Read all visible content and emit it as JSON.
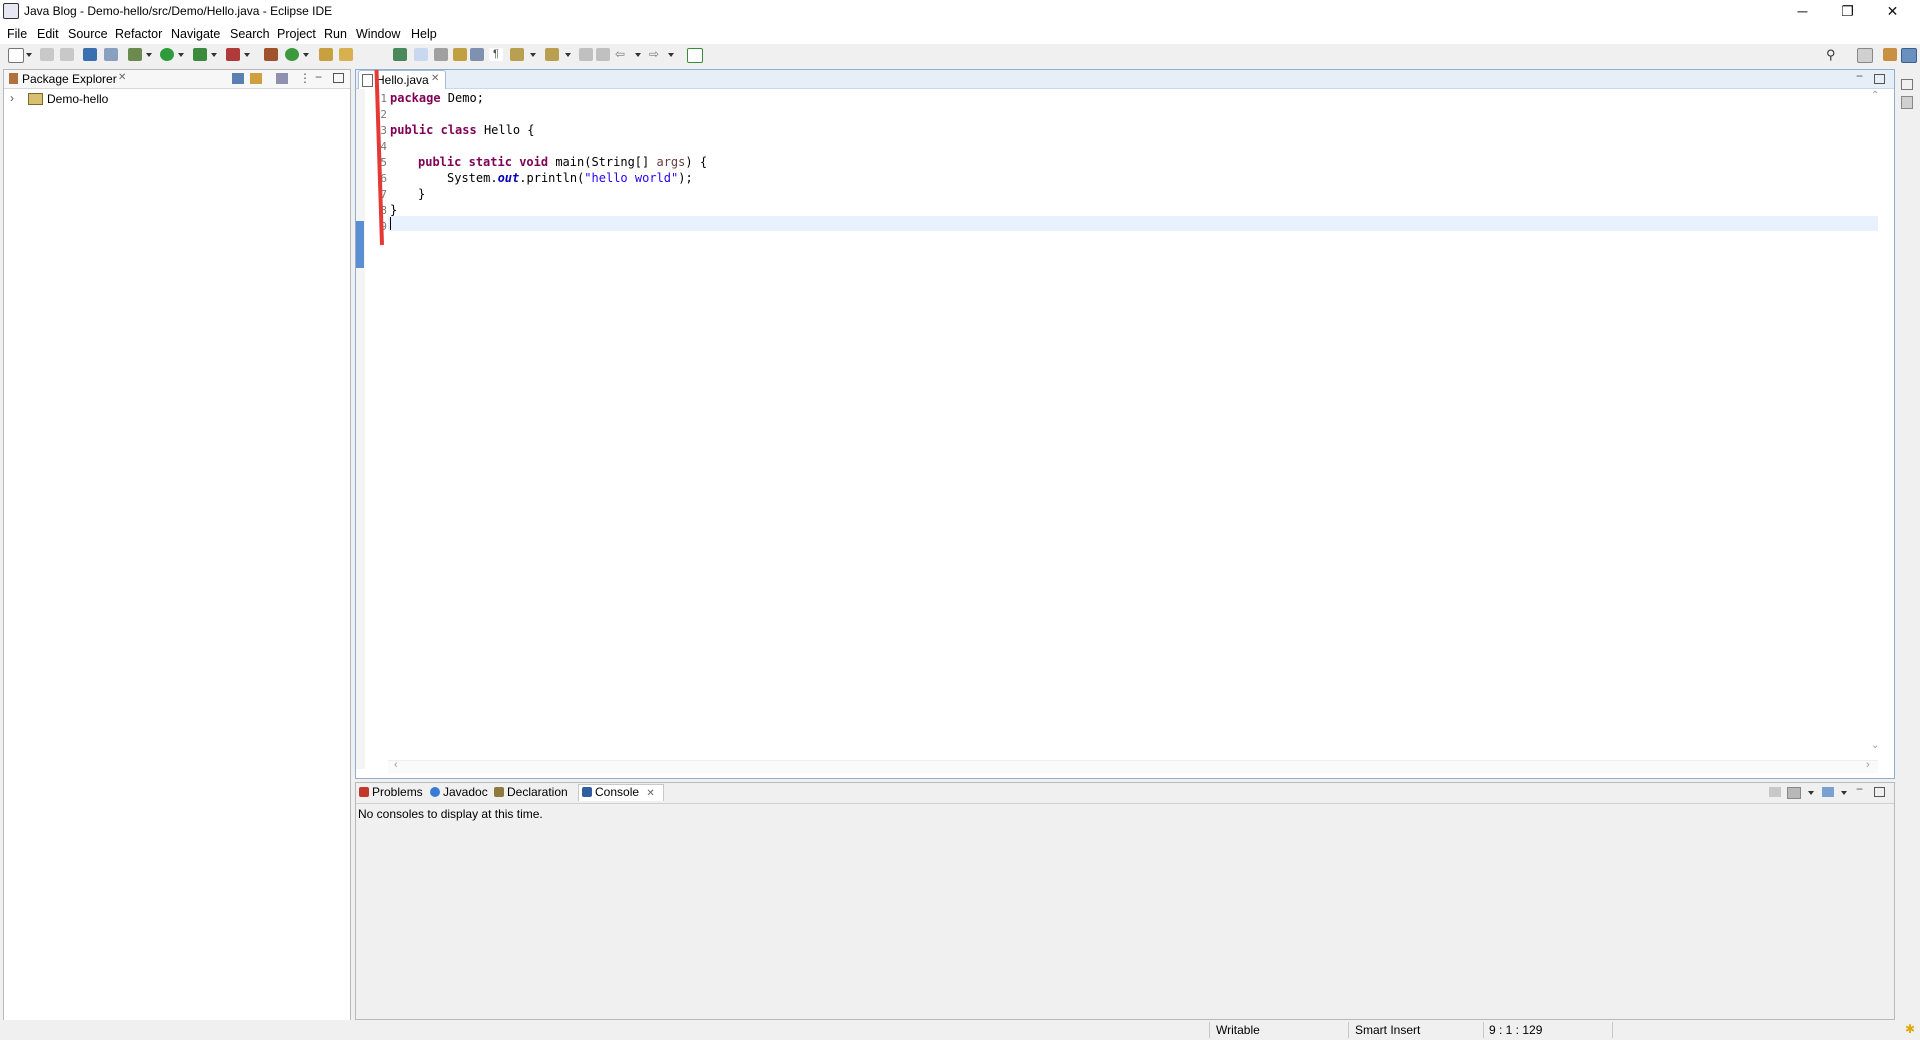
{
  "window": {
    "title": "Java Blog - Demo-hello/src/Demo/Hello.java - Eclipse IDE",
    "controls": {
      "minimize": "─",
      "restore": "❐",
      "close": "✕"
    }
  },
  "menu": [
    "File",
    "Edit",
    "Source",
    "Refactor",
    "Navigate",
    "Search",
    "Project",
    "Run",
    "Window",
    "Help"
  ],
  "package_explorer": {
    "title": "Package Explorer",
    "close": "✕",
    "items": [
      {
        "label": "Demo-hello",
        "expander": "›"
      }
    ]
  },
  "editor": {
    "tab_label": "Hello.java",
    "tab_close": "✕",
    "line_numbers": [
      "1",
      "2",
      "3",
      "4",
      "5",
      "6",
      "7",
      "8",
      "9"
    ],
    "lines": {
      "l1_kw": "package",
      "l1_rest": " Demo;",
      "l3_kw1": "public",
      "l3_kw2": "class",
      "l3_rest": " Hello {",
      "l5_kw1": "public",
      "l5_kw2": "static",
      "l5_kw3": "void",
      "l5_mid": " main(String[] ",
      "l5_param": "args",
      "l5_end": ") {",
      "l6_a": "System.",
      "l6_out": "out",
      "l6_b": ".println(",
      "l6_str": "\"hello world\"",
      "l6_c": ");",
      "l7": "}",
      "l8": "}"
    }
  },
  "console_view": {
    "tabs": [
      {
        "label": "Problems",
        "color": "#c0392b"
      },
      {
        "label": "Javadoc",
        "color": "#3a7bd5"
      },
      {
        "label": "Declaration",
        "color": "#8e7a3a"
      },
      {
        "label": "Console",
        "color": "#2f5fa0"
      }
    ],
    "close": "✕",
    "message": "No consoles to display at this time."
  },
  "status_bar": {
    "writable": "Writable",
    "insert_mode": "Smart Insert",
    "position": "9 : 1 : 129"
  },
  "colors": {
    "annotation_arrow": "#e53935",
    "keyword": "#7f0055",
    "string": "#2a00ff",
    "current_line": "#e8f2fe"
  }
}
